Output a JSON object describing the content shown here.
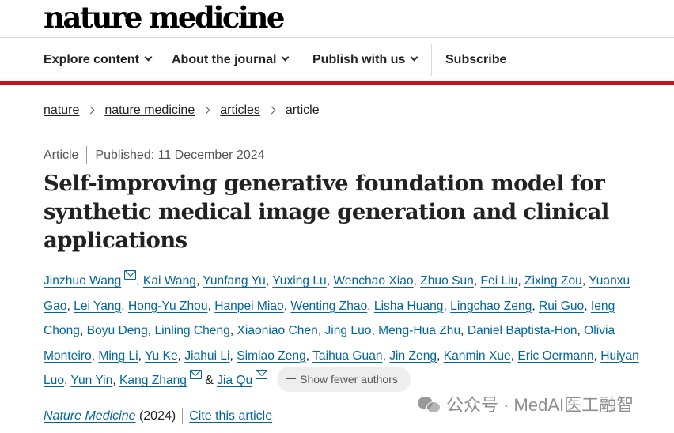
{
  "site": {
    "logo": "nature medicine"
  },
  "nav": {
    "explore": "Explore content",
    "about": "About the journal",
    "publish": "Publish with us",
    "subscribe": "Subscribe"
  },
  "breadcrumb": [
    "nature",
    "nature medicine",
    "articles",
    "article"
  ],
  "meta": {
    "type": "Article",
    "published": "Published: 11 December 2024"
  },
  "title": "Self-improving generative foundation model for synthetic medical image generation and clinical applications",
  "authors": [
    {
      "name": "Jinzhuo Wang",
      "mail": true
    },
    {
      "name": "Kai Wang"
    },
    {
      "name": "Yunfang Yu"
    },
    {
      "name": "Yuxing Lu"
    },
    {
      "name": "Wenchao Xiao"
    },
    {
      "name": "Zhuo Sun"
    },
    {
      "name": "Fei Liu"
    },
    {
      "name": "Zixing Zou"
    },
    {
      "name": "Yuanxu Gao"
    },
    {
      "name": "Lei Yang"
    },
    {
      "name": "Hong-Yu Zhou"
    },
    {
      "name": "Hanpei Miao"
    },
    {
      "name": "Wenting Zhao"
    },
    {
      "name": "Lisha Huang"
    },
    {
      "name": "Lingchao Zeng"
    },
    {
      "name": "Rui Guo"
    },
    {
      "name": "Ieng Chong"
    },
    {
      "name": "Boyu Deng"
    },
    {
      "name": "Linling Cheng"
    },
    {
      "name": "Xiaoniao Chen"
    },
    {
      "name": "Jing Luo"
    },
    {
      "name": "Meng-Hua Zhu"
    },
    {
      "name": "Daniel Baptista-Hon"
    },
    {
      "name": "Olivia Monteiro"
    },
    {
      "name": "Ming Li"
    },
    {
      "name": "Yu Ke"
    },
    {
      "name": "Jiahui Li"
    },
    {
      "name": "Simiao Zeng"
    },
    {
      "name": "Taihua Guan"
    },
    {
      "name": "Jin Zeng"
    },
    {
      "name": "Kanmin Xue"
    },
    {
      "name": "Eric Oermann"
    },
    {
      "name": "Huiyan Luo"
    },
    {
      "name": "Yun Yin"
    },
    {
      "name": "Kang Zhang",
      "mail": true
    },
    {
      "name": "Jia Qu",
      "mail": true
    }
  ],
  "authors_last_joiner": "&",
  "show_fewer_label": "Show fewer authors",
  "citation": {
    "journal": "Nature Medicine",
    "year": "(2024)",
    "cite_label": "Cite this article"
  },
  "watermark": "公众号 · MedAI医工融智",
  "colors": {
    "accent_red": "#c5121c",
    "link": "#006699"
  }
}
